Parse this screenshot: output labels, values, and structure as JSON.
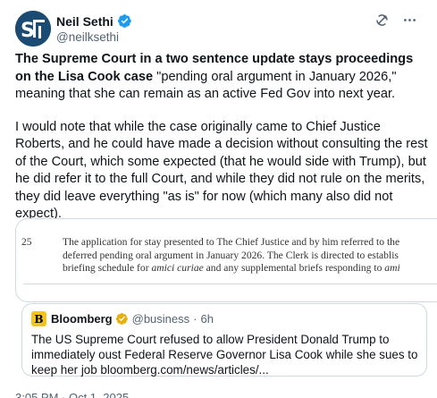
{
  "author": {
    "name": "Neil Sethi",
    "handle": "@neilksethi",
    "verified_color": "#1d9bf0"
  },
  "icons": {
    "grok": "grok-icon",
    "more": "more-icon"
  },
  "tweet": {
    "bold_lead": "The Supreme Court in a two sentence update stays proceedings on the Lisa Cook case",
    "rest_para1": " \"pending oral argument in January 2026,\" meaning that she can remain as an active Fed Gov into next year.",
    "para2": "I would note that while the case originally came to Chief Justice Roberts, and he could have made a decision without consulting the rest of the Court, which some expected (that he would side with Trump), but he did refer it to the full Court, and while they did not rule on the merits, they did leave everything \"as is\" for now (which many also did not expect)."
  },
  "document_image": {
    "line_number": "25",
    "line1": "The application for stay presented to The Chief Justice and by him referred to the",
    "line2": "deferred pending oral argument in January 2026. The Clerk is directed to establis",
    "line3_pre": "briefing schedule for ",
    "line3_italic1": "amici curiae",
    "line3_mid": " and any supplemental briefs responding to ",
    "line3_italic2": "ami"
  },
  "quote": {
    "name": "Bloomberg",
    "handle": "@business",
    "separator": "·",
    "time": "6h",
    "logo_letter": "B",
    "brand_color": "#f2c41c",
    "verified_color": "#e8b00f",
    "text": "The US Supreme Court refused to allow President Donald Trump to immediately oust Federal Reserve Governor Lisa Cook while she sues to keep her job bloomberg.com/news/articles/..."
  },
  "timestamp": "3:05 PM · Oct 1, 2025"
}
